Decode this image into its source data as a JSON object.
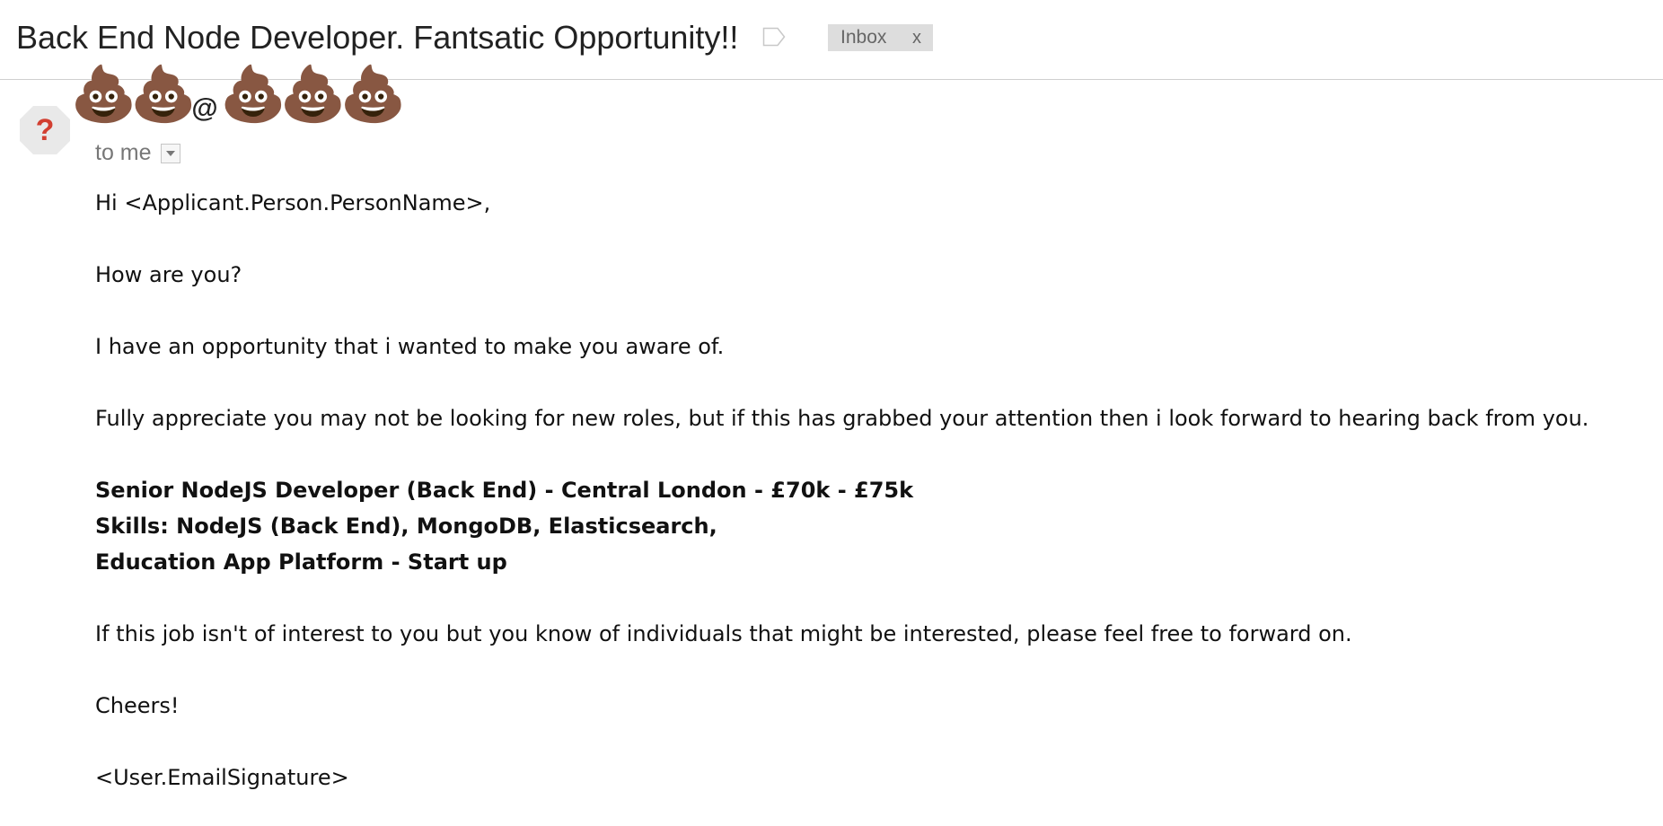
{
  "header": {
    "subject": "Back End Node Developer. Fantsatic Opportunity!!",
    "label": "Inbox",
    "label_close": "x",
    "label_bg_color": "#dddddd"
  },
  "sender": {
    "avatar_icon": "question-mark-icon",
    "name_emoji": "💩💩",
    "at_sign": "@",
    "domain_emoji": "💩💩💩"
  },
  "recipient": {
    "text": "to me"
  },
  "body": {
    "greeting": "Hi <Applicant.Person.PersonName>,",
    "question": "How are you?",
    "intro": "I have an opportunity that i wanted to make you aware of.",
    "appreciation": "Fully appreciate you may not be looking for new roles, but if this has grabbed your attention then i look forward to hearing back from you.",
    "role_title": "Senior NodeJS Developer (Back End) - Central London - £70k - £75k",
    "skills": "Skills: NodeJS (Back End), MongoDB, Elasticsearch,",
    "company": "Education App Platform - Start up",
    "referral": "If this job isn't of interest to you but you know of individuals that might be interested, please feel free  to forward on.",
    "signoff": "Cheers!",
    "signature": "<User.EmailSignature>"
  }
}
